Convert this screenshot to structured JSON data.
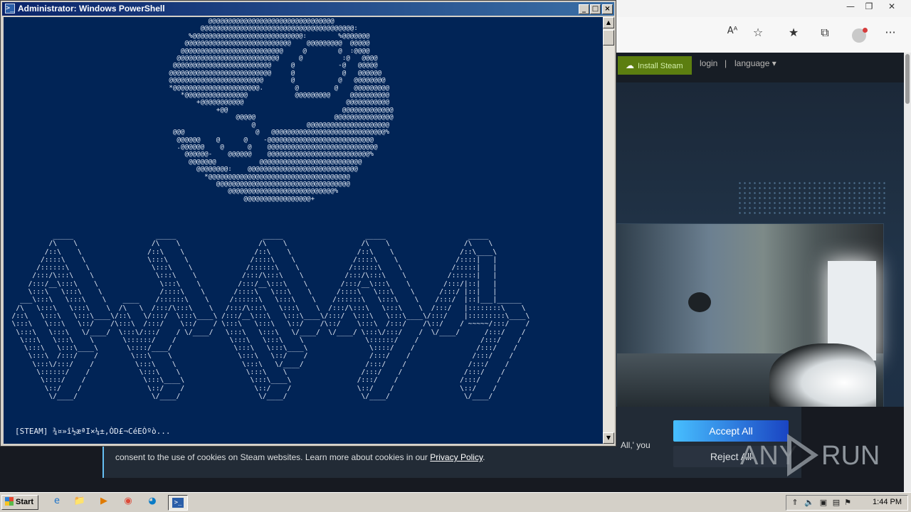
{
  "browser": {
    "toolbar_icons": [
      "read-aloud-icon",
      "add-favorite-icon",
      "favorites-icon",
      "collections-icon",
      "profile-avatar",
      "more-icon"
    ],
    "read_aloud_glyph": "Aᴬ",
    "more_glyph": "···",
    "steam": {
      "install_label": "Install Steam",
      "login_label": "login",
      "separator": "|",
      "language_label": "language",
      "language_caret": "▾"
    },
    "cookie": {
      "text_line1_tail": "All,' you",
      "text_line2": "consent to the use of cookies on Steam websites. Learn more about cookies in our",
      "privacy_link": "Privacy Policy",
      "text_line2_end": ".",
      "accept_label": "Accept All",
      "reject_label": "Reject All"
    },
    "colors": {
      "steam_bg": "#1b2838",
      "install_green": "#5c7e10",
      "accept_blue": "#47bfff"
    }
  },
  "watermark": {
    "left": "ANY",
    "right": "RUN"
  },
  "powershell": {
    "title": "Administrator: Windows PowerShell",
    "title_icon": ">_",
    "controls": {
      "minimize": "_",
      "maximize": "□",
      "close": "×"
    },
    "ascii_skull": "                                                    @@@@@@@@@@@@@@@@@@@@@@@@@@@@@@@@\n                                                  @@@@@@@@@@@@@@@@@@@@@@@@@@@@@@@@@@@@@@@:\n                                               %@@@@@@@@@@@@@@@@@@@@@@@@@@@@:        %@@@@@@@\n                                              @@@@@@@@@@@@@@@@@@@@@@@@@@@    @@@@@@@@@  @@@@@\n                                             @@@@@@@@@@@@@@@@@@@@@@@@@@     @        @  :@@@@\n                                            @@@@@@@@@@@@@@@@@@@@@@@@@@     @          :@   @@@@\n                                           @@@@@@@@@@@@@@@@@@@@@@@@@     @           -@   @@@@@\n                                          @@@@@@@@@@@@@@@@@@@@@@@@@@     @            @   @@@@@@\n                                          @@@@@@@@@@@@@@@@@@@@@@@@       @           @   @@@@@@@@\n                                          *@@@@@@@@@@@@@@@@@@@@@@.        @         @    @@@@@@@@@\n                                             *@@@@@@@@@@@@@@@@            @@@@@@@@@     @@@@@@@@@@\n                                                 +@@@@@@@@@@@                          @@@@@@@@@@@\n                                                      +@@                             @@@@@@@@@@@@@\n                                                           @@@@@                    @@@@@@@@@@@@@@@\n                                                               @             @@@@@@@@@@@@@@@@@@@@@\n                                           @@@                  @   @@@@@@@@@@@@@@@@@@@@@@@@@@@@@%\n                                            @@@@@@    @      @    -@@@@@@@@@@@@@@@@@@@@@@@@@@@\n                                            .@@@@@@    @      @    @@@@@@@@@@@@@@@@@@@@@@@@@@@@\n                                              @@@@@@-    @@@@@@    @@@@@@@@@@@@@@@@@@@@@@@@@@%\n                                               @@@@@@@           @@@@@@@@@@@@@@@@@@@@@@@@@@\n                                                 @@@@@@@@:    @@@@@@@@@@@@@@@@@@@@@@@@@@@@\n                                                   *@@@@@@@@@@@@@@@@@@@@@@@@@@@@@@@@@@@@\n                                                      @@@@@@@@@@@@@@@@@@@@@@@@@@@@@@@@@@\n                                                         @@@@@@@@@@@@@@@@@@@@@@@@@@@%\n                                                             @@@@@@@@@@@@@@@@@+",
    "ascii_banner": "            _____                    _____                     _____                    _____                    _____\n           /\\    \\                  /\\    \\                   /\\    \\                  /\\    \\                  /\\    \\\n          /::\\    \\                /::\\    \\                 /::\\    \\                /::\\    \\                /::\\____\\\n         /::::\\    \\               \\:::\\    \\               /::::\\    \\              /::::\\    \\              /::::|   |\n        /::::::\\    \\               \\:::\\    \\             /::::::\\    \\            /::::::\\    \\            /:::::|   |\n       /:::/\\:::\\    \\               \\:::\\    \\           /:::/\\:::\\    \\          /:::/\\:::\\    \\          /::::::|   |\n      /:::/__\\:::\\    \\               \\:::\\    \\         /:::/__\\:::\\    \\        /:::/__\\:::\\    \\        /:::/|::|   |\n      \\:::\\   \\:::\\    \\              /::::\\    \\       /::::\\   \\:::\\    \\      /::::\\   \\:::\\    \\      /:::/ |::|   |\n    ___\\:::\\   \\:::\\    \\    ____    /::::::\\    \\     /::::::\\   \\:::\\    \\    /::::::\\   \\:::\\    \\    /:::/  |::|___|______\n   /\\   \\:::\\   \\:::\\    \\  /\\   \\  /:::/\\:::\\    \\   /:::/\\:::\\   \\:::\\    \\  /:::/\\:::\\   \\:::\\    \\  /:::/   |::::::::\\    \\\n  /::\\   \\:::\\   \\:::\\____\\/::\\   \\/:::/  \\:::\\____\\ /:::/__\\:::\\   \\:::\\____\\/:::/  \\:::\\   \\:::\\____\\/:::/    |:::::::::\\____\\\n  \\:::\\   \\:::\\   \\::/    /\\:::\\  /:::/    \\::/    / \\:::\\   \\:::\\   \\::/    /\\::/    \\:::\\  /:::/    /\\::/    / ~~~~~/:::/    /\n   \\:::\\   \\:::\\   \\/____/  \\:::\\/:::/    / \\/____/   \\:::\\   \\:::\\   \\/____/  \\/____/ \\:::\\/:::/    /  \\/____/      /:::/    /\n    \\:::\\   \\:::\\    \\       \\::::::/    /             \\:::\\   \\:::\\    \\               \\::::::/    /               /:::/    /\n     \\:::\\   \\:::\\____\\       \\::::/____/               \\:::\\   \\:::\\____\\               \\::::/    /               /:::/    /\n      \\:::\\  /:::/    /        \\:::\\    \\                \\:::\\   \\::/    /               /:::/    /               /:::/    /\n       \\:::\\/:::/    /          \\:::\\    \\                \\:::\\   \\/____/               /:::/    /               /:::/    /\n        \\::::::/    /            \\:::\\    \\                \\:::\\    \\                  /:::/    /               /:::/    /\n         \\::::/    /              \\:::\\____\\                \\:::\\____\\                /:::/    /               /:::/    /\n          \\::/    /                \\::/    /                 \\::/    /                \\::/    /                \\::/    /\n           \\/____/                  \\/____/                   \\/____/                  \\/____/                  \\/____/",
    "prompt_line": "[STEAM] ¾¤»î½æªI×¼±,ÒD£¬CéEÒºò..."
  },
  "taskbar": {
    "start_label": "Start",
    "quick_launch": [
      "ie-icon",
      "explorer-icon",
      "media-player-icon",
      "chrome-icon",
      "edge-icon",
      "powershell-icon"
    ],
    "tray_icons": [
      "tray-expand-icon",
      "volume-icon",
      "network-icon",
      "display-icon",
      "flag-icon"
    ],
    "clock": "1:44 PM"
  }
}
